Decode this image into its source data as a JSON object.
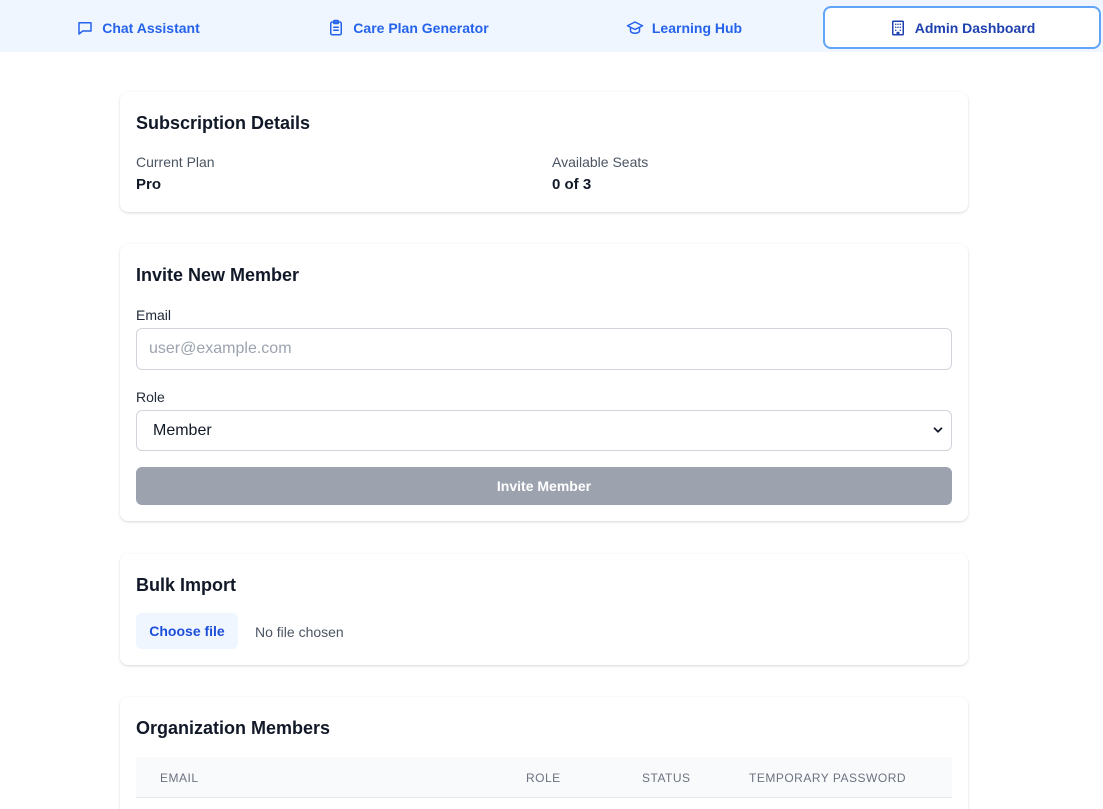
{
  "nav": {
    "tabs": [
      {
        "label": "Chat Assistant",
        "icon": "chat-bubble-icon"
      },
      {
        "label": "Care Plan Generator",
        "icon": "clipboard-list-icon"
      },
      {
        "label": "Learning Hub",
        "icon": "graduation-cap-icon"
      },
      {
        "label": "Admin Dashboard",
        "icon": "building-icon",
        "active": true
      }
    ]
  },
  "subscription": {
    "title": "Subscription Details",
    "plan_label": "Current Plan",
    "plan_value": "Pro",
    "seats_label": "Available Seats",
    "seats_value": "0 of 3"
  },
  "invite": {
    "title": "Invite New Member",
    "email_label": "Email",
    "email_placeholder": "user@example.com",
    "email_value": "",
    "role_label": "Role",
    "role_value": "Member",
    "button_label": "Invite Member"
  },
  "bulk": {
    "title": "Bulk Import",
    "choose_label": "Choose file",
    "status": "No file chosen"
  },
  "members": {
    "title": "Organization Members",
    "columns": [
      "Email",
      "Role",
      "Status",
      "Temporary Password"
    ]
  },
  "colors": {
    "accent": "#2563eb",
    "nav_bg": "#eff6ff",
    "disabled_button": "#9ca3af"
  }
}
